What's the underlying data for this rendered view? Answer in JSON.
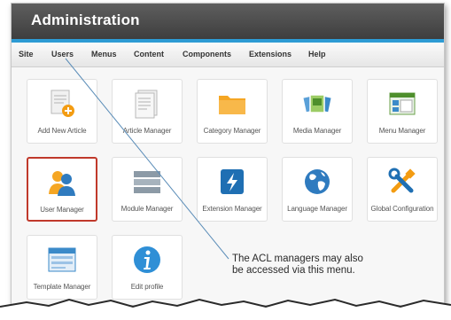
{
  "header": {
    "title": "Administration"
  },
  "menu": [
    {
      "label": "Site"
    },
    {
      "label": "Users"
    },
    {
      "label": "Menus"
    },
    {
      "label": "Content"
    },
    {
      "label": "Components"
    },
    {
      "label": "Extensions"
    },
    {
      "label": "Help"
    }
  ],
  "tiles": [
    {
      "label": "Add New Article",
      "icon": "add-article-icon"
    },
    {
      "label": "Article Manager",
      "icon": "article-icon"
    },
    {
      "label": "Category Manager",
      "icon": "folder-icon"
    },
    {
      "label": "Media Manager",
      "icon": "media-icon"
    },
    {
      "label": "Menu Manager",
      "icon": "menu-icon"
    },
    {
      "label": "User Manager",
      "icon": "users-icon"
    },
    {
      "label": "Module Manager",
      "icon": "module-icon"
    },
    {
      "label": "Extension Manager",
      "icon": "extension-icon"
    },
    {
      "label": "Language Manager",
      "icon": "globe-icon"
    },
    {
      "label": "Global Configuration",
      "icon": "tools-icon"
    },
    {
      "label": "Template Manager",
      "icon": "template-icon"
    },
    {
      "label": "Edit profile",
      "icon": "info-icon"
    }
  ],
  "annotation": {
    "line1": "The ACL managers may also",
    "line2": "be accessed via this menu."
  },
  "colors": {
    "header_bg": "#4a4a4a",
    "accent_bar": "#2d9bd4",
    "highlight_border": "#c0392b",
    "callout_line": "#5b8db8"
  }
}
